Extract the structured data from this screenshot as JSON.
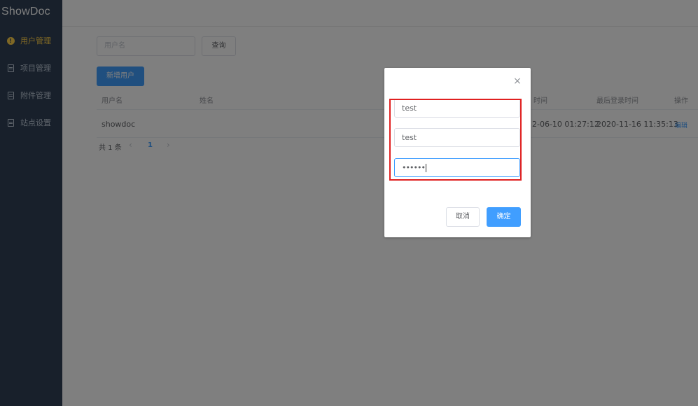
{
  "app": {
    "brand": "ShowDoc"
  },
  "sidebar": {
    "items": [
      {
        "label": "用户管理",
        "icon": "info-icon",
        "active": true
      },
      {
        "label": "项目管理",
        "icon": "document-icon",
        "active": false
      },
      {
        "label": "附件管理",
        "icon": "document-icon",
        "active": false
      },
      {
        "label": "站点设置",
        "icon": "document-icon",
        "active": false
      }
    ]
  },
  "toolbar": {
    "search_placeholder": "用户名",
    "query_label": "查询",
    "add_user_label": "新增用户"
  },
  "table": {
    "headers": [
      "用户名",
      "姓名",
      "时间",
      "最后登录时间",
      "操作"
    ],
    "rows": [
      {
        "username": "showdoc",
        "name": "",
        "reg_time": "2-06-10 01:27:12",
        "last_login": "2020-11-16 11:35:13",
        "action": "编辑"
      }
    ]
  },
  "pagination": {
    "total_label": "共 1 条",
    "prev": "‹",
    "current": "1",
    "next": "›"
  },
  "dialog": {
    "close_icon": "close-icon",
    "fields": [
      {
        "value": "test"
      },
      {
        "value": "test"
      },
      {
        "value": "••••••"
      }
    ],
    "cancel_label": "取消",
    "confirm_label": "确定"
  },
  "colors": {
    "sidebar_bg": "#304156",
    "active": "#ffd04b",
    "primary": "#409eff",
    "highlight": "#e02020"
  }
}
